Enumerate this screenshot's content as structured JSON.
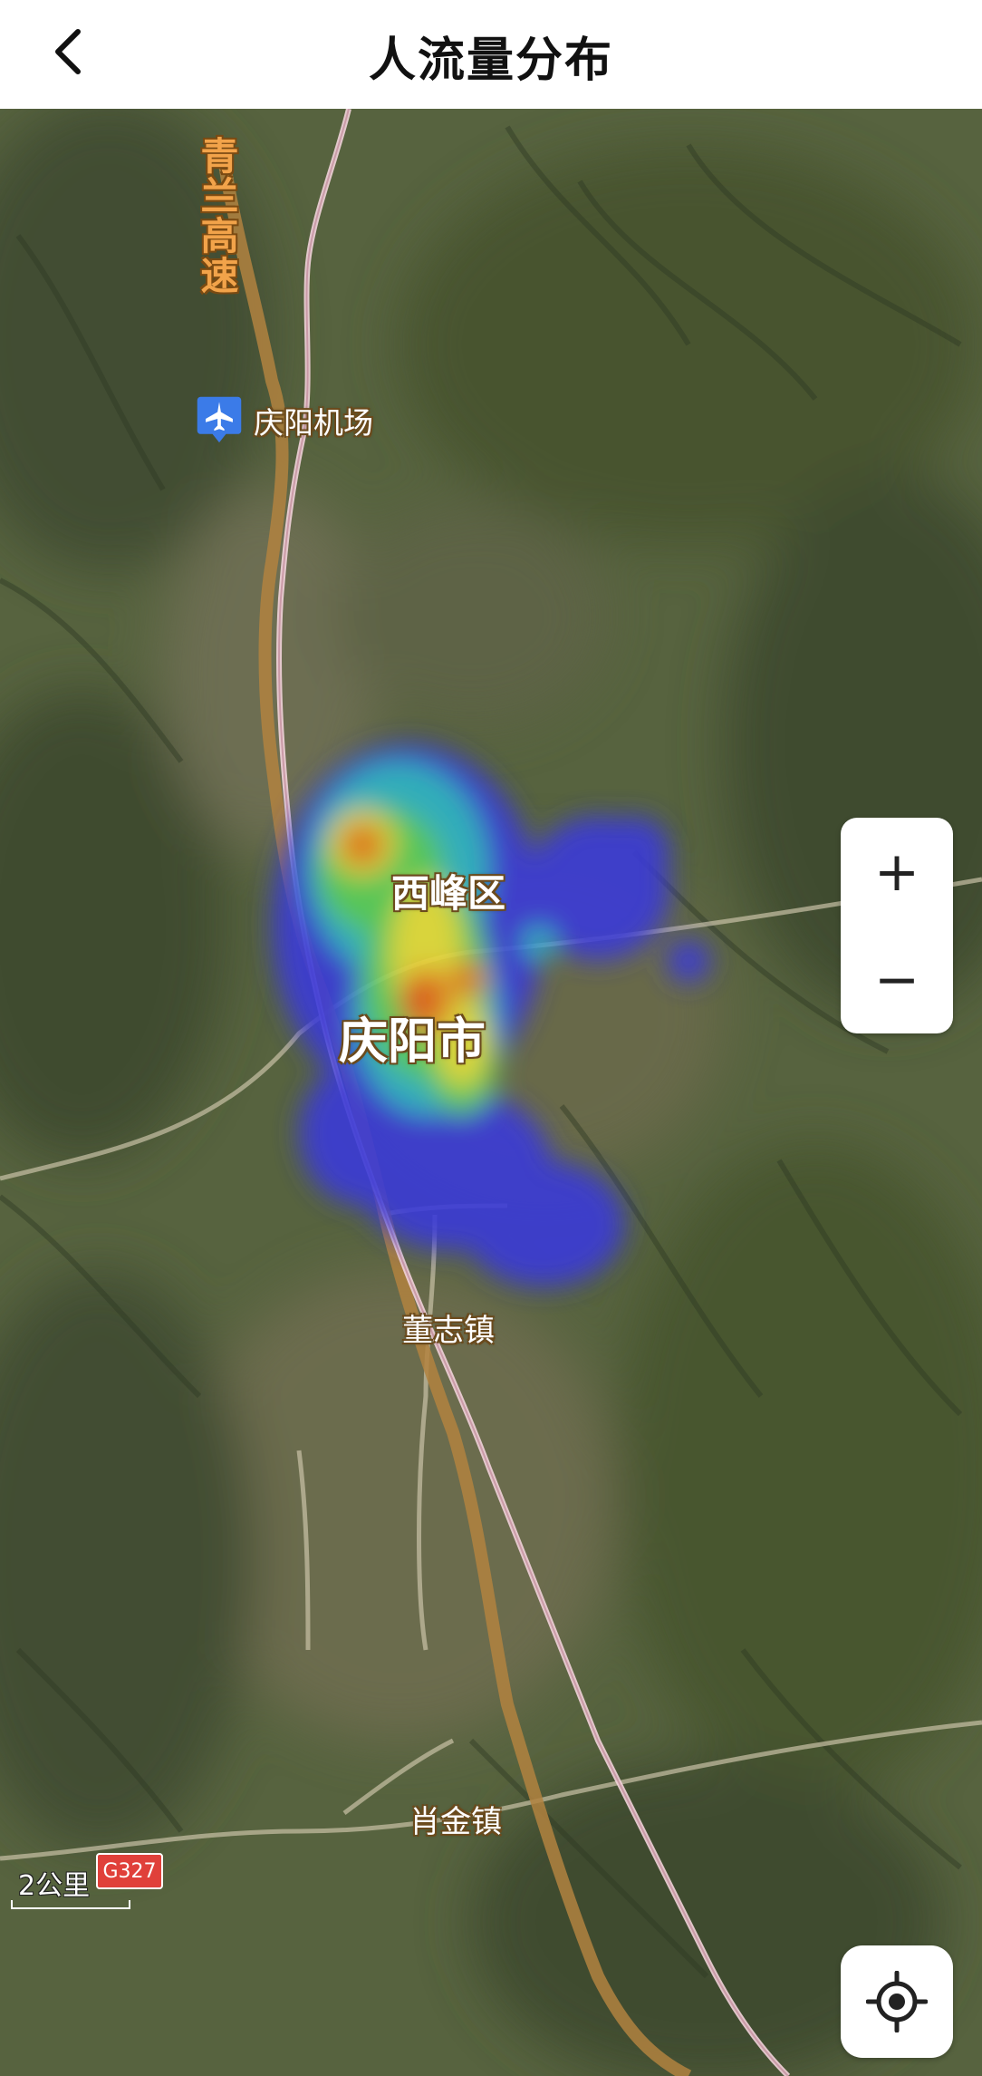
{
  "header": {
    "title": "人流量分布",
    "back_icon": "chevron-left-icon"
  },
  "map": {
    "highway_label": "青兰高速",
    "airport_label": "庆阳机场",
    "places": {
      "xifeng": "西峰区",
      "qingyang": "庆阳市",
      "dongzhi": "董志镇",
      "xiaojin": "肖金镇"
    },
    "scale_label": "2公里",
    "road_shield": "G327",
    "heatmap_colors": [
      "#3a3ad8",
      "#2fb6c8",
      "#58d05a",
      "#e6e03a",
      "#e8781e",
      "#e01e1e"
    ]
  },
  "controls": {
    "zoom_in": "+",
    "zoom_out": "−",
    "locate_icon": "locate-icon"
  }
}
